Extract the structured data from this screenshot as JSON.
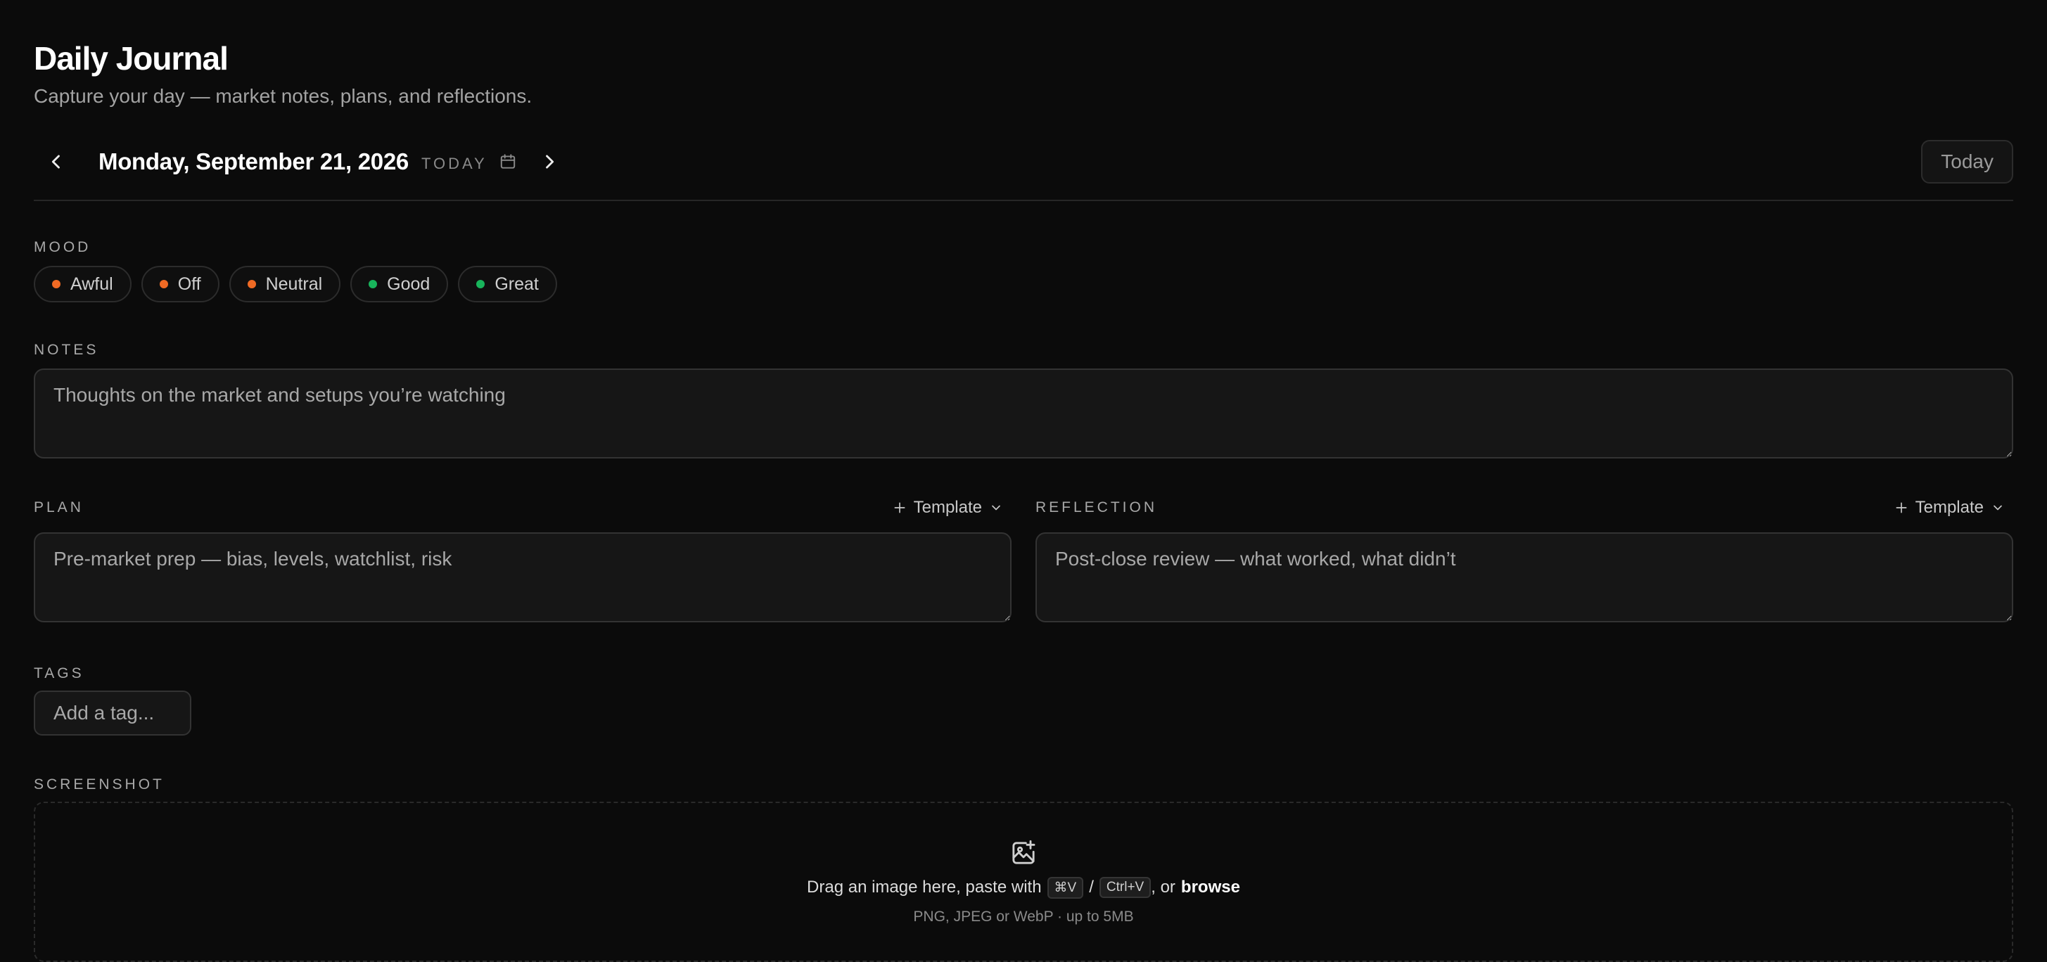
{
  "header": {
    "title": "Daily Journal",
    "subtitle": "Capture your day — market notes, plans, and reflections."
  },
  "datebar": {
    "date": "Monday, September 21, 2026",
    "today_tag": "TODAY",
    "today_button": "Today"
  },
  "mood": {
    "label": "MOOD",
    "options": [
      {
        "label": "Awful",
        "color": "#f06a24"
      },
      {
        "label": "Off",
        "color": "#f06a24"
      },
      {
        "label": "Neutral",
        "color": "#f06a24"
      },
      {
        "label": "Good",
        "color": "#18b45b"
      },
      {
        "label": "Great",
        "color": "#18b45b"
      }
    ]
  },
  "notes": {
    "label": "NOTES",
    "placeholder": "Thoughts on the market and setups you’re watching"
  },
  "plan": {
    "label": "PLAN",
    "template_label": "Template",
    "placeholder": "Pre-market prep — bias, levels, watchlist, risk"
  },
  "reflection": {
    "label": "REFLECTION",
    "template_label": "Template",
    "placeholder": "Post-close review — what worked, what didn’t"
  },
  "tags": {
    "label": "TAGS",
    "placeholder": "Add a tag..."
  },
  "screenshot": {
    "label": "SCREENSHOT",
    "drop_text_1": "Drag an image here, paste with",
    "key_mac": "⌘V",
    "separator": "/",
    "key_win": "Ctrl+V",
    "drop_text_2": ", or",
    "browse": "browse",
    "formats": "PNG, JPEG or WebP · up to 5MB"
  },
  "icons": {
    "prev": "chevron-left-icon",
    "next": "chevron-right-icon",
    "calendar": "calendar-icon",
    "plus": "plus-icon",
    "chevron_down": "chevron-down-icon",
    "image_add": "image-plus-icon"
  }
}
